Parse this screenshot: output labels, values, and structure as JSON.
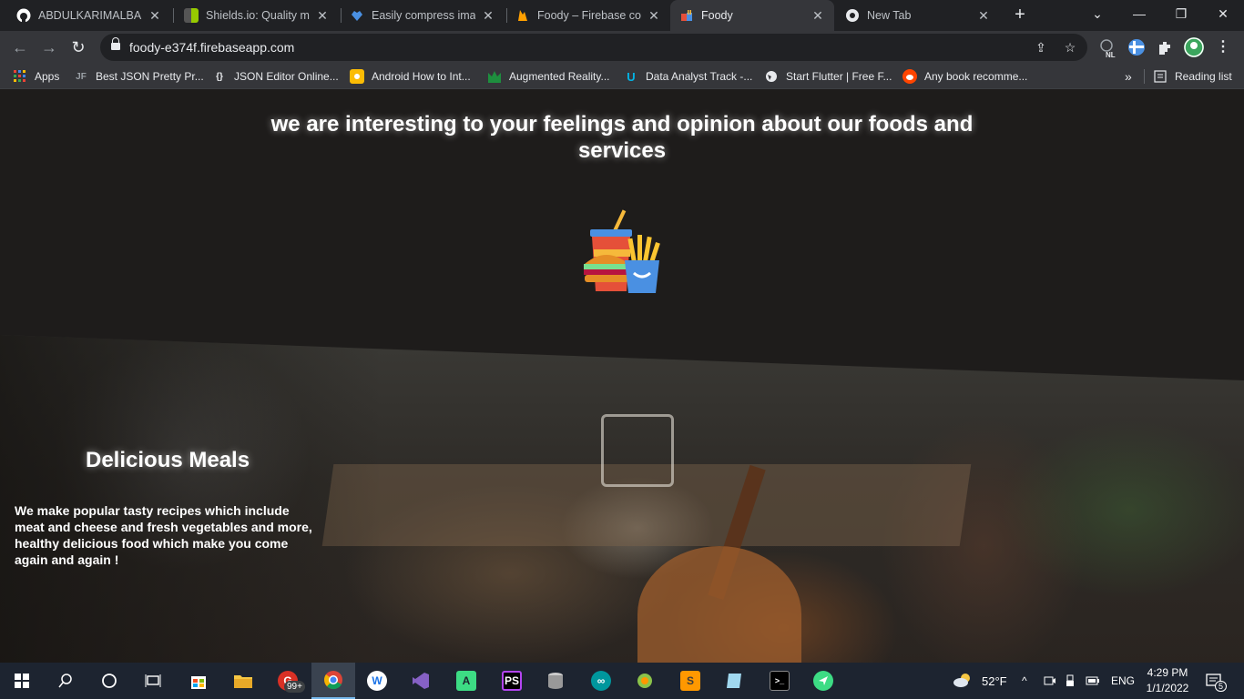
{
  "tabs": [
    {
      "title": "ABDULKARIMALBAIK/",
      "favicon": "github-icon",
      "color": "#ffffff"
    },
    {
      "title": "Shields.io: Quality met",
      "favicon": "shields-icon",
      "color": "#97ca00"
    },
    {
      "title": "Easily compress image",
      "favicon": "heart-icon",
      "color": "#4a90e2"
    },
    {
      "title": "Foody – Firebase cons",
      "favicon": "firebase-icon",
      "color": "#ffa000"
    },
    {
      "title": "Foody",
      "favicon": "foody-icon",
      "color": "#f6b93b",
      "active": true
    },
    {
      "title": "New Tab",
      "favicon": "chrome-icon",
      "color": "#e8eaed"
    }
  ],
  "address_bar": {
    "url": "foody-e374f.firebaseapp.com"
  },
  "extensions": {
    "badge": "NL"
  },
  "bookmarks": [
    {
      "label": "Apps",
      "icon": "apps-grid-icon"
    },
    {
      "label": "Best JSON Pretty Pr...",
      "icon": "jf-icon",
      "glyph": "JF"
    },
    {
      "label": "JSON Editor Online...",
      "icon": "braces-icon",
      "glyph": "{}"
    },
    {
      "label": "Android How to Int...",
      "icon": "android-bookmark-icon"
    },
    {
      "label": "Augmented Reality...",
      "icon": "ar-icon"
    },
    {
      "label": "Data Analyst Track -...",
      "icon": "udacity-icon",
      "glyph": "U"
    },
    {
      "label": "Start Flutter | Free F...",
      "icon": "globe-icon"
    },
    {
      "label": "Any book recomme...",
      "icon": "reddit-icon"
    }
  ],
  "bookmarks_overflow": "»",
  "reading_list": "Reading list",
  "page": {
    "headline": "we are  interesting to your feelings and opinion about our foods and services",
    "section_title": "Delicious Meals",
    "section_text": "We make popular tasty recipes which include meat and cheese and fresh vegetables and more, healthy delicious food which make you come again and again !"
  },
  "taskbar": {
    "badge_count": "99+",
    "weather": "52°F",
    "language": "ENG",
    "time": "4:29 PM",
    "date": "1/1/2022",
    "notifications": "5"
  }
}
